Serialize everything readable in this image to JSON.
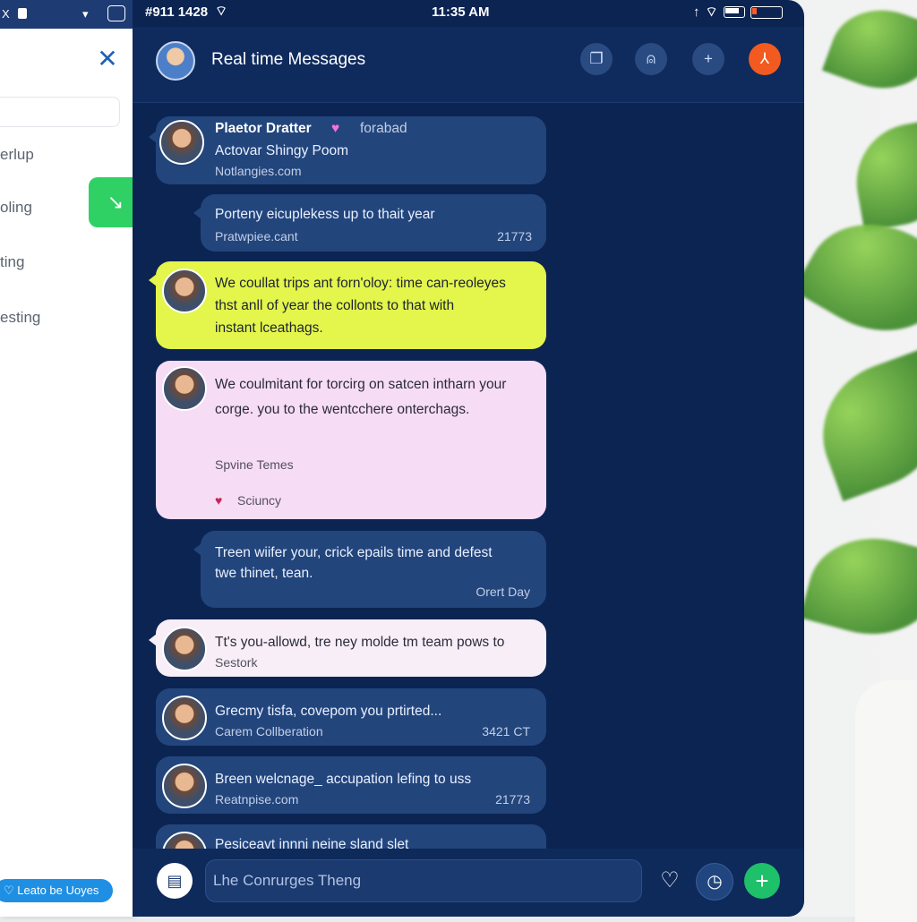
{
  "side_panel": {
    "status_left": "X",
    "items": [
      "erlup",
      "oling",
      "ting",
      "esting"
    ],
    "pill_label": "Leato be Uoyes"
  },
  "status_bar": {
    "left": "#911 1428",
    "time": "11:35 AM"
  },
  "header": {
    "title": "Real time Messages"
  },
  "messages": [
    {
      "style": "dark",
      "sender": "Plaetor Dratter",
      "heart": "♥",
      "tag": "forabad",
      "text": "Actovar Shingy Poom",
      "sub": "Notlangies.com",
      "has_avatar": true
    },
    {
      "style": "dark",
      "text": "Porteny eicuplekess up to thait year",
      "sub": "Pratwpiee.cant",
      "meta": "21773"
    },
    {
      "style": "yellow",
      "text_lines": [
        "We coullat trips ant forn'oloy: time can-reoleyes",
        "thst anll of year the collonts to that with",
        "instant lceathags."
      ],
      "has_avatar": true
    },
    {
      "style": "pink",
      "text_lines": [
        "We coulmitant for torcirg on satcen intharn your",
        "corge. you to the wentcchere onterchags."
      ],
      "sub": "Spvine Temes",
      "meta": "Sciuncy",
      "has_avatar": true
    },
    {
      "style": "dark",
      "text_lines": [
        "Treen wiifer your, crick epails time and defest",
        "twe thinet, tean."
      ],
      "meta": "Orert Day"
    },
    {
      "style": "light",
      "text": "Tt's you-allowd, tre ney molde tm team pows to",
      "sub": "Sestork",
      "has_avatar": true
    },
    {
      "style": "dark",
      "text": "Grecmy tisfa, covepom you prtirted...",
      "sub": "Carem Collberation",
      "meta": "3421 CT",
      "has_avatar": true
    },
    {
      "style": "dark",
      "text": "Breen welcnage_ accupation lefing to uss",
      "sub": "Reatnpise.com",
      "meta": "21773",
      "has_avatar": true
    },
    {
      "style": "dark",
      "text": "Pesiceavt innnj neine sland slet",
      "has_avatar": true
    }
  ],
  "composer": {
    "placeholder": "Lhe Conrurges Theng"
  },
  "colors": {
    "app_bg": "#0b2452",
    "bubble_dark": "#22457c",
    "bubble_yellow": "#e4f54b",
    "bubble_pink": "#f7dcf6",
    "accent_orange": "#f25a1f",
    "accent_green": "#1ec06a"
  },
  "icons": [
    "close-icon",
    "wifi-icon",
    "battery-icon",
    "book-icon",
    "user-icon",
    "plus-icon",
    "profile-icon",
    "chat-icon",
    "heart-icon",
    "timer-icon",
    "add-icon"
  ]
}
